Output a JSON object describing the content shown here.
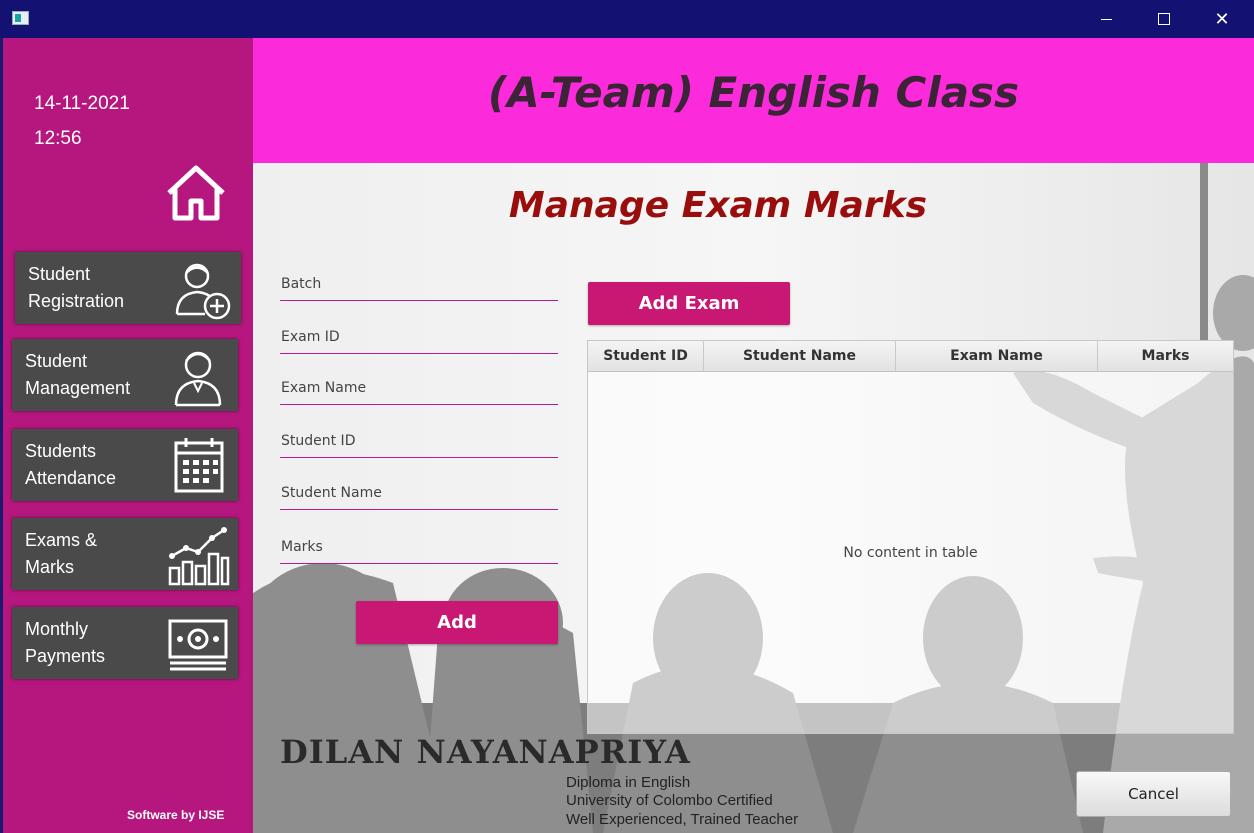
{
  "window": {
    "app_icon": "app-window-icon",
    "controls": [
      "minimize-icon",
      "maximize-icon",
      "close-icon"
    ]
  },
  "sidebar": {
    "date": "14-11-2021",
    "time": "12:56",
    "home_icon": "home-icon",
    "items": [
      {
        "line1": "Student",
        "line2": "Registration",
        "icon": "add-user-icon"
      },
      {
        "line1": "Student",
        "line2": "Management",
        "icon": "user-icon"
      },
      {
        "line1": "Students",
        "line2": "Attendance",
        "icon": "calendar-icon"
      },
      {
        "line1": "Exams &",
        "line2": "Marks",
        "icon": "chart-growth-icon"
      },
      {
        "line1": "Monthly",
        "line2": "Payments",
        "icon": "money-icon"
      }
    ],
    "credit": "Software by IJSE"
  },
  "header": {
    "title": "(A-Team) English Class"
  },
  "main": {
    "title": "Manage Exam Marks",
    "fields": {
      "batch": "Batch",
      "exam_id": "Exam ID",
      "exam_name": "Exam Name",
      "student_id": "Student ID",
      "student_name": "Student Name",
      "marks": "Marks"
    },
    "add_button": "Add",
    "add_exam_button": "Add Exam",
    "table": {
      "columns": [
        "Student ID",
        "Student Name",
        "Exam Name",
        "Marks"
      ],
      "empty_message": "No content in table"
    },
    "signature": "DILAN NAYANAPRIYA",
    "credentials": [
      "Diploma in English",
      "University of Colombo Certified",
      "Well Experienced, Trained Teacher"
    ],
    "cancel_button": "Cancel"
  },
  "colors": {
    "titlebar": "#131172",
    "sidebar": "#b5177f",
    "header": "#fb2bdb",
    "accent_button": "#c81873",
    "page_title": "#9a0d0d"
  }
}
